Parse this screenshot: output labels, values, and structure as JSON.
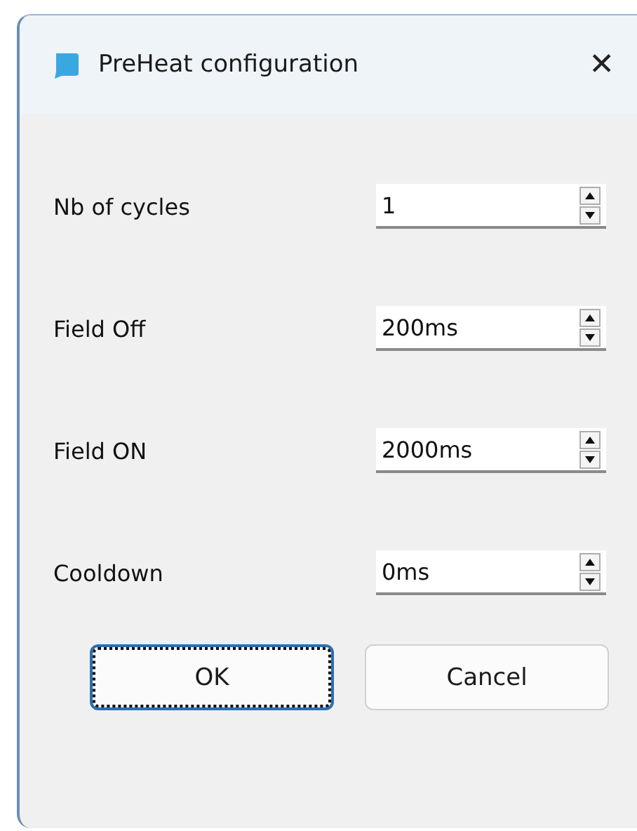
{
  "window": {
    "title": "PreHeat configuration",
    "close": "✕"
  },
  "fields": [
    {
      "label": "Nb of cycles",
      "value": "1"
    },
    {
      "label": "Field Off",
      "value": "200ms"
    },
    {
      "label": "Field ON",
      "value": "2000ms"
    },
    {
      "label": "Cooldown",
      "value": "0ms"
    }
  ],
  "buttons": [
    {
      "label": "OK",
      "focused": true
    },
    {
      "label": "Cancel",
      "focused": false
    }
  ]
}
